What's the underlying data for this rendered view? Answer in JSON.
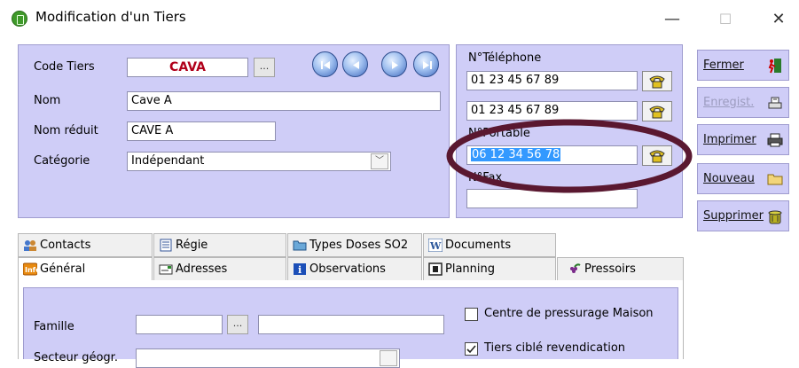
{
  "window": {
    "title": "Modification d'un Tiers",
    "minimize": "—",
    "maximize": "☐",
    "close": "✕"
  },
  "ident": {
    "code_label": "Code Tiers",
    "code_value": "CAVA",
    "browse": "...",
    "nom_label": "Nom",
    "nom_value": "Cave A",
    "nom_reduit_label": "Nom réduit",
    "nom_reduit_value": "CAVE A",
    "categorie_label": "Catégorie",
    "categorie_value": "Indépendant"
  },
  "contact": {
    "telephone_label": "N°Téléphone",
    "telephone_1": "01 23 45 67 89",
    "telephone_2": "01 23 45 67 89",
    "portable_label": "N°Portable",
    "portable_value": "06 12 34 56 78",
    "fax_label": "N°Fax",
    "fax_value": ""
  },
  "actions": {
    "fermer": "Fermer",
    "enregistrer": "Enregist.",
    "imprimer": "Imprimer",
    "nouveau": "Nouveau",
    "supprimer": "Supprimer"
  },
  "tabs_row1": {
    "contacts": "Contacts",
    "regie": "Régie",
    "types_doses": "Types Doses SO2",
    "documents": "Documents"
  },
  "tabs_row2": {
    "general": "Général",
    "adresses": "Adresses",
    "observations": "Observations",
    "planning": "Planning",
    "pressoirs": "Pressoirs"
  },
  "general": {
    "famille_label": "Famille",
    "famille_code": "",
    "famille_browse": "...",
    "famille_name": "",
    "secteur_label": "Secteur géogr.",
    "secteur_value": "",
    "centre_label": "Centre de pressurage Maison",
    "centre_checked": false,
    "tiers_label": "Tiers ciblé revendication",
    "tiers_checked": true
  },
  "colors": {
    "panel": "#cfcdf7",
    "highlight": "#3399ff",
    "annotation_ellipse": "#5a1830",
    "code_red": "#b0001a"
  }
}
